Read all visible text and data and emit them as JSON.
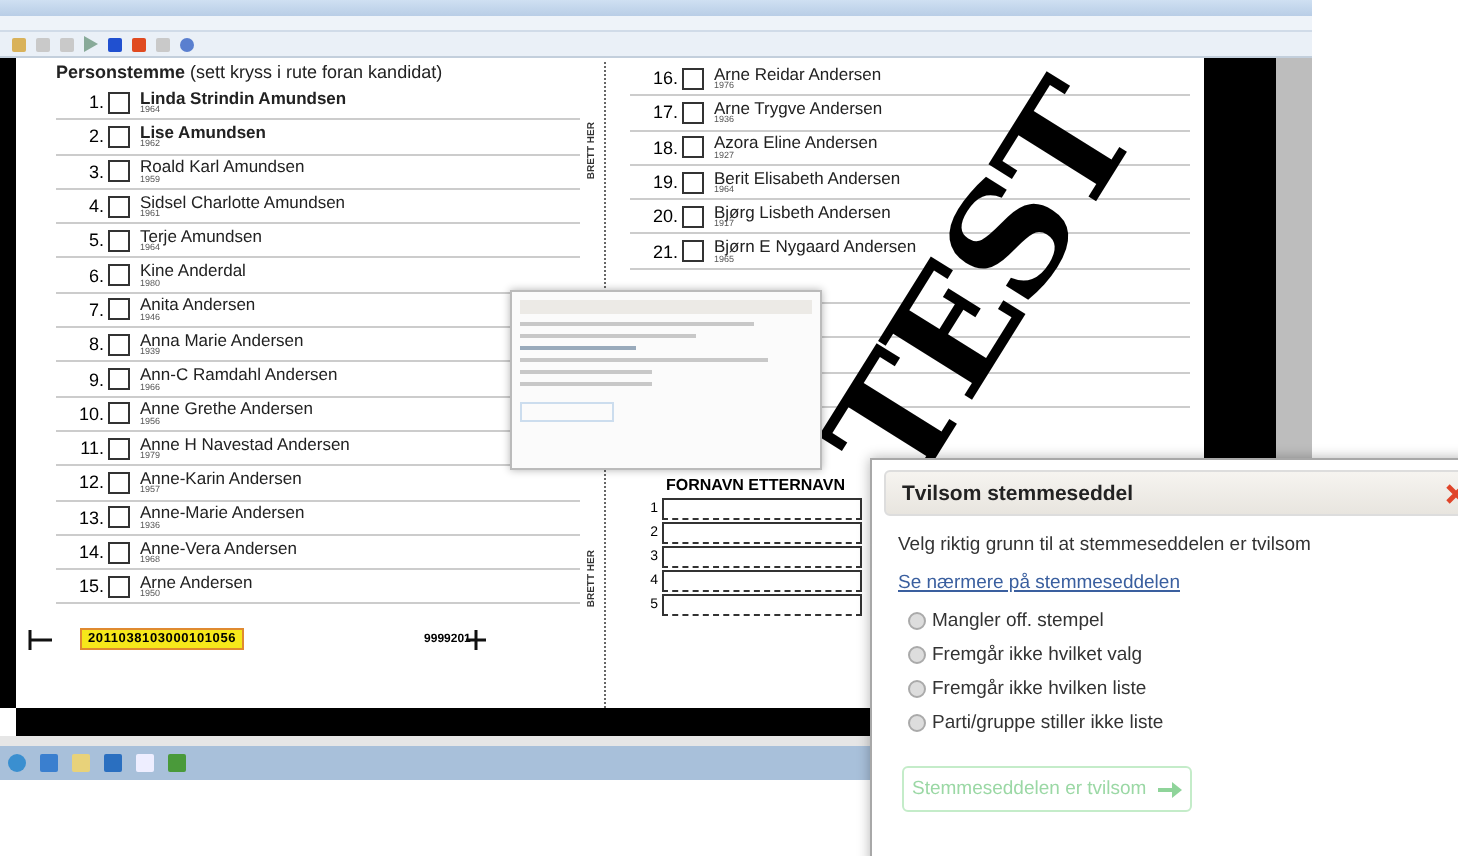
{
  "ballot": {
    "heading": "**Personstemme** (sett kryss i rute foran kandidat)",
    "fold_label_top": "BRETT HER",
    "fold_label_bottom": "BRETT HER",
    "candidates": [
      {
        "number": "1.",
        "name": "Linda Strindin Amundsen",
        "year": "1964",
        "bold": true,
        "checked": false
      },
      {
        "number": "2.",
        "name": "Lise Amundsen",
        "year": "1962",
        "bold": true,
        "checked": false
      },
      {
        "number": "3.",
        "name": "Roald Karl Amundsen",
        "year": "1959",
        "bold": false,
        "checked": false
      },
      {
        "number": "4.",
        "name": "Sidsel Charlotte Amundsen",
        "year": "1961",
        "bold": false,
        "checked": false
      },
      {
        "number": "5.",
        "name": "Terje Amundsen",
        "year": "1964",
        "bold": false,
        "checked": false
      },
      {
        "number": "6.",
        "name": "Kine Anderdal",
        "year": "1980",
        "bold": false,
        "checked": false
      },
      {
        "number": "7.",
        "name": "Anita Andersen",
        "year": "1946",
        "bold": false,
        "checked": false
      },
      {
        "number": "8.",
        "name": "Anna Marie Andersen",
        "year": "1939",
        "bold": false,
        "checked": false
      },
      {
        "number": "9.",
        "name": "Ann-C Ramdahl Andersen",
        "year": "1966",
        "bold": false,
        "checked": false
      },
      {
        "number": "10.",
        "name": "Anne Grethe Andersen",
        "year": "1956",
        "bold": false,
        "checked": false
      },
      {
        "number": "11.",
        "name": "Anne H Navestad Andersen",
        "year": "1979",
        "bold": false,
        "checked": false
      },
      {
        "number": "12.",
        "name": "Anne-Karin Andersen",
        "year": "1957",
        "bold": false,
        "checked": false
      },
      {
        "number": "13.",
        "name": "Anne-Marie Andersen",
        "year": "1936",
        "bold": false,
        "checked": false
      },
      {
        "number": "14.",
        "name": "Anne-Vera Andersen",
        "year": "1968",
        "bold": false,
        "checked": false
      },
      {
        "number": "15.",
        "name": "Arne Andersen",
        "year": "1950",
        "bold": false,
        "checked": false
      }
    ],
    "candidates_right": [
      {
        "number": "16.",
        "name": "Arne Reidar Andersen",
        "year": "1976",
        "bold": false,
        "checked": false
      },
      {
        "number": "17.",
        "name": "Arne Trygve Andersen",
        "year": "1936",
        "bold": false,
        "checked": false
      },
      {
        "number": "18.",
        "name": "Azora Eline Andersen",
        "year": "1927",
        "bold": false,
        "checked": false
      },
      {
        "number": "19.",
        "name": "Berit Elisabeth Andersen",
        "year": "1964",
        "bold": false,
        "checked": false
      },
      {
        "number": "20.",
        "name": "Bjørg Lisbeth Andersen",
        "year": "1917",
        "bold": false,
        "checked": false
      },
      {
        "number": "21.",
        "name": "Bjørn E Nygaard Andersen",
        "year": "1965",
        "bold": false,
        "checked": false
      }
    ],
    "write_in": {
      "heading": "FORNAVN ETTERNAVN",
      "lines": [
        "1",
        "2",
        "3",
        "4",
        "5"
      ]
    },
    "barcode": "2011038103000101056",
    "code": "9999201",
    "stamp": "TEST"
  },
  "dialog": {
    "title": "Tvilsom stemmeseddel",
    "prompt": "Velg riktig grunn til at stemmeseddelen er tvilsom",
    "link": "Se nærmere på stemmeseddelen",
    "options": [
      {
        "label": "Mangler  off. stempel",
        "selected": false
      },
      {
        "label": "Fremgår ikke hvilket valg",
        "selected": false
      },
      {
        "label": "Fremgår ikke hvilken liste",
        "selected": false
      },
      {
        "label": "Parti/gruppe stiller ikke liste",
        "selected": false
      }
    ],
    "button": {
      "label": "Stemmeseddelen er tvilsom",
      "disabled": true
    }
  }
}
